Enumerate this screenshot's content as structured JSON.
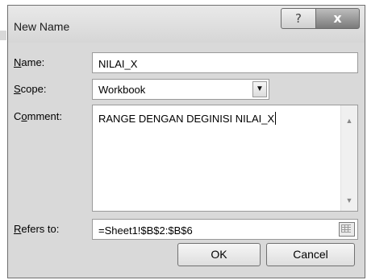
{
  "window": {
    "title": "New Name",
    "help_label": "?",
    "close_label": "x"
  },
  "form": {
    "name": {
      "label_u": "N",
      "label_rest": "ame:",
      "value": "NILAI_X"
    },
    "scope": {
      "label_u": "S",
      "label_rest": "cope:",
      "value": "Workbook"
    },
    "comment": {
      "label_pre": "C",
      "label_u": "o",
      "label_rest": "mment:",
      "value": "RANGE DENGAN DEGINISI NILAI_X"
    },
    "refers_to": {
      "label_u": "R",
      "label_rest": "efers to:",
      "value": "=Sheet1!$B$2:$B$6"
    }
  },
  "buttons": {
    "ok": "OK",
    "cancel": "Cancel"
  },
  "icons": {
    "dropdown": "chevron-down-icon",
    "collapse": "range-collapse-icon",
    "scroll_up": "scroll-up-icon",
    "scroll_down": "scroll-down-icon"
  }
}
